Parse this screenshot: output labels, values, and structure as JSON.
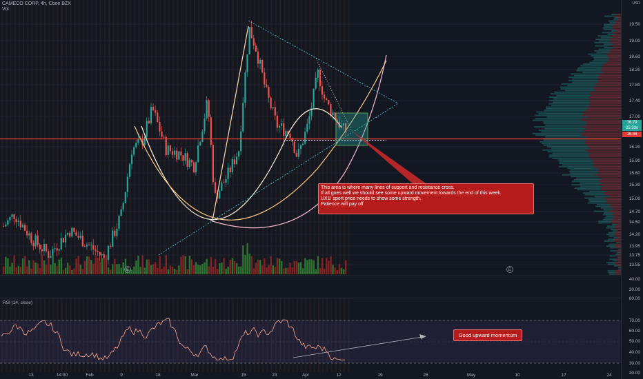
{
  "header": {
    "symbol_line": "CAMECO CORP, 4h, Cboe BZX",
    "volume_label": "Vol"
  },
  "axis": {
    "currency": "USD",
    "price_ticks": [
      "19.50",
      "19.00",
      "18.60",
      "18.20",
      "17.80",
      "17.40",
      "17.00",
      "16.20",
      "15.90",
      "15.60",
      "15.30",
      "15.00",
      "14.70",
      "14.50",
      "14.20",
      "13.95",
      "13.75",
      "13.55"
    ],
    "volume_ticks": [
      "40.00",
      "20.00"
    ],
    "rsi_ticks": [
      "80.00",
      "70.00",
      "60.00",
      "50.00",
      "40.00",
      "30.00",
      "20.00"
    ],
    "current_price_badge": "16.79",
    "current_time_badge": "25:33s",
    "line_price_badge": "16.66"
  },
  "time_axis": [
    "13",
    "14:00",
    "Feb",
    "9",
    "18",
    "Mar",
    "15",
    "23",
    "Apr",
    "12",
    "19",
    "26",
    "May",
    "10",
    "17",
    "24"
  ],
  "rsi": {
    "title": "RSI (14, close)"
  },
  "annotations": {
    "main_note": "This area is where many lines of support and resistance cross.\n  If all goes well we should see some upward movement towards the end of this week.\nUX1! sport price needs to show some strength.\nPatience will pay off",
    "momentum_note": "Good upward momentum"
  },
  "event_markers": [
    "E",
    "E"
  ],
  "colors": {
    "background": "#131722",
    "bull": "#26a69a",
    "bear": "#ef5350",
    "support_line": "#e53935",
    "rsi_band": "#7e57c2",
    "annotation_bg": "#b71c1c"
  },
  "chart_data": {
    "type": "candlestick",
    "title": "CAMECO CORP, 4h, Cboe BZX",
    "ylim": [
      13.4,
      19.8
    ],
    "horizontal_line": 16.66,
    "last_price": 16.79,
    "rsi_levels": [
      70,
      30
    ]
  }
}
